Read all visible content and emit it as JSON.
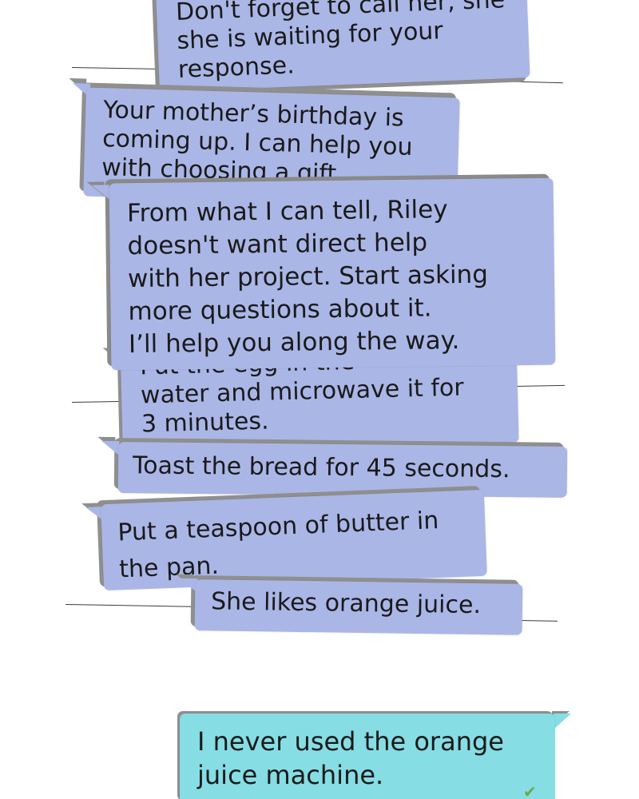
{
  "colors": {
    "bot_bubble": "#aab6e6",
    "bot_shadow": "#8f8f8f",
    "user_bubble": "#86dde4",
    "user_shadow": "#8f8f8f",
    "check": "#6aa94a",
    "divider": "#3a3a3a"
  },
  "messages": [
    {
      "id": "m1",
      "lines": [
        "Don't forget to call her, she",
        "she is waiting for your",
        "response."
      ]
    },
    {
      "id": "m2",
      "lines": [
        "Your mother’s birthday is",
        "coming up. I can help you",
        "with choosing a gift."
      ]
    },
    {
      "id": "m3",
      "lines": [
        "Put the egg in the",
        "water and microwave it for",
        "3 minutes."
      ]
    },
    {
      "id": "m4",
      "lines": [
        "From what I can tell, Riley",
        "doesn't want direct help",
        "with her project. Start asking",
        "more questions about it.",
        "I’ll help you along the way."
      ]
    },
    {
      "id": "m5",
      "lines": [
        "Toast the bread for 45 seconds."
      ]
    },
    {
      "id": "m6",
      "lines": [
        "Put a teaspoon of butter in",
        "the pan."
      ]
    },
    {
      "id": "m7",
      "lines": [
        "She likes orange juice."
      ]
    }
  ],
  "user_message": {
    "lines": [
      "I never used the orange",
      "juice machine."
    ],
    "status_icon": "double-check-icon"
  }
}
